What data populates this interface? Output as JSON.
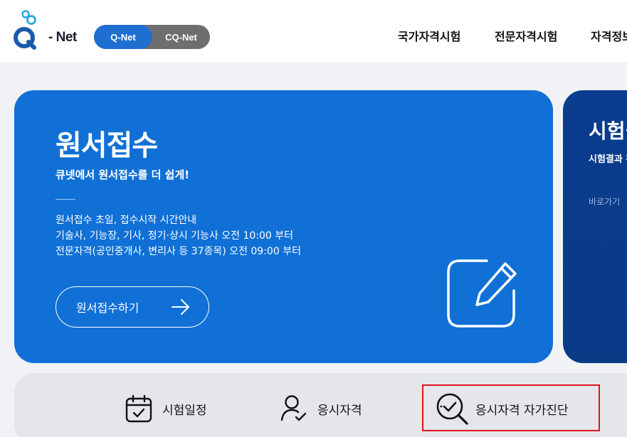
{
  "header": {
    "logo_text": "- Net",
    "toggle": {
      "active": "Q-Net",
      "inactive": "CQ-Net"
    },
    "nav": [
      "국가자격시험",
      "전문자격시험",
      "자격정보"
    ]
  },
  "main_card": {
    "title": "원서접수",
    "subtitle": "큐넷에서 원서접수를 더 쉽게!",
    "desc_lines": [
      "원서접수 초일, 접수시작 시간안내",
      "기술사, 기능장, 기사, 정기·상시 기능사 오전 10:00 부터",
      "전문자격(공인중개사, 변리사 등 37종목) 오전 09:00 부터"
    ],
    "button_label": "원서접수하기"
  },
  "second_card": {
    "title": "시험결과",
    "subtitle": "시험결과 확인",
    "link": "바로가기"
  },
  "quick_links": [
    {
      "label": "시험일정",
      "icon": "calendar-check-icon"
    },
    {
      "label": "응시자격",
      "icon": "user-check-icon"
    },
    {
      "label": "응시자격 자가진단",
      "icon": "search-check-icon"
    }
  ],
  "colors": {
    "brand_blue": "#1070d6",
    "toggle_active": "#1f6fd1",
    "toggle_inactive": "#6e6e6e",
    "dark_card": "#0a3d8f",
    "highlight": "#e0141e"
  }
}
